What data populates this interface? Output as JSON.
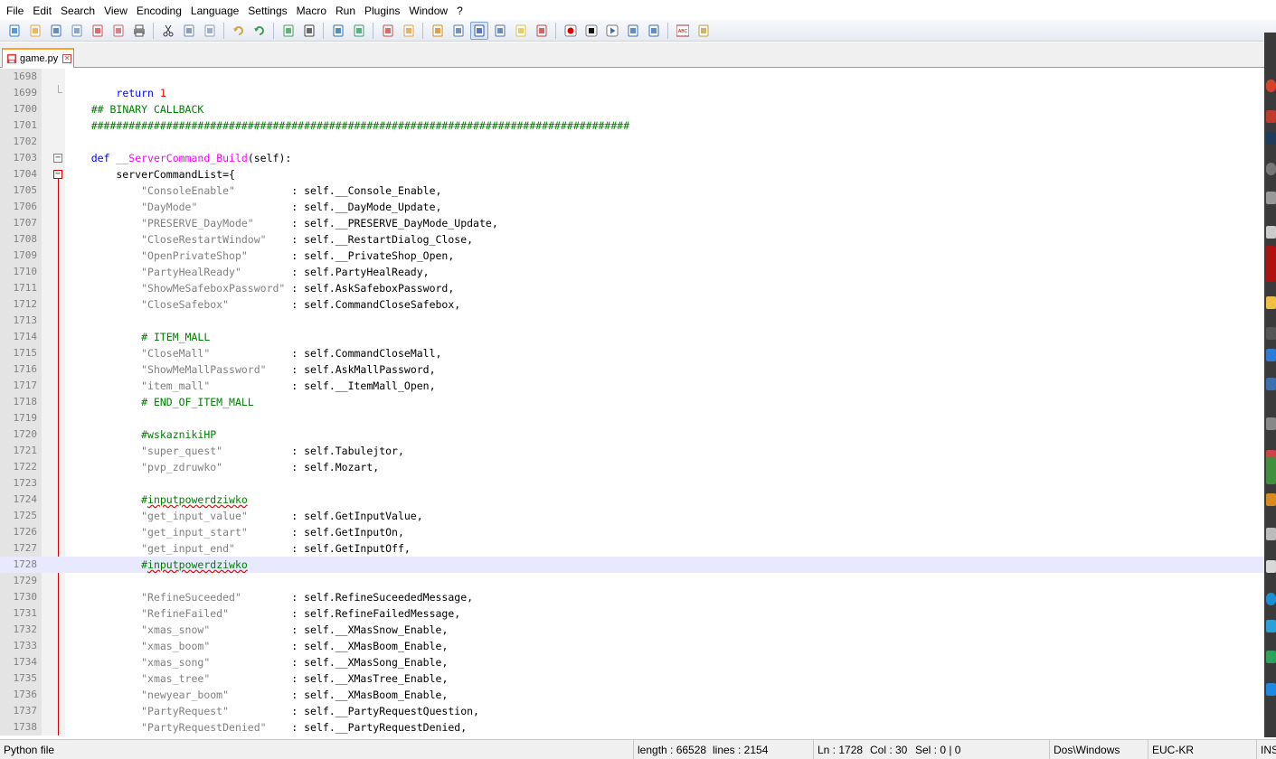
{
  "menu": [
    "File",
    "Edit",
    "Search",
    "View",
    "Encoding",
    "Language",
    "Settings",
    "Macro",
    "Run",
    "Plugins",
    "Window",
    "?"
  ],
  "toolbar": {
    "buttons": [
      "new-file-icon",
      "open-file-icon",
      "save-icon",
      "save-all-icon",
      "close-icon",
      "close-all-icon",
      "print-icon",
      "sep",
      "cut-icon",
      "copy-icon",
      "paste-icon",
      "sep",
      "undo-icon",
      "redo-icon",
      "sep",
      "find-icon",
      "replace-icon",
      "sep",
      "zoom-in-icon",
      "zoom-out-icon",
      "sep",
      "sync-vertical-icon",
      "sync-horizontal-icon",
      "sep",
      "word-wrap-icon",
      "show-all-chars-icon",
      "indent-guide-icon",
      "user-language-icon",
      "doc-map-icon",
      "function-list-icon",
      "sep",
      "record-macro-icon",
      "stop-macro-icon",
      "play-macro-icon",
      "run-macro-multiple-icon",
      "save-macro-icon",
      "sep",
      "spell-check-icon",
      "plugin-icon"
    ],
    "active": "indent-guide-icon"
  },
  "tabs": [
    {
      "label": "game.py"
    }
  ],
  "editor": {
    "current_line": "1728",
    "lines": [
      {
        "n": "1698",
        "fold": "",
        "html": ""
      },
      {
        "n": "1699",
        "fold": "end",
        "html": "        <span class='kw'>return</span> <span class='num'>1</span>"
      },
      {
        "n": "1700",
        "fold": "",
        "html": "    <span class='cmt'>## BINARY CALLBACK</span>"
      },
      {
        "n": "1701",
        "fold": "",
        "html": "    <span class='cmt'>######################################################################################</span>"
      },
      {
        "n": "1702",
        "fold": "",
        "html": ""
      },
      {
        "n": "1703",
        "fold": "minus",
        "html": "    <span class='kw'>def</span> <span class='fn'>__ServerCommand_Build</span>(self):"
      },
      {
        "n": "1704",
        "fold": "minus-red",
        "html": "        serverCommandList={"
      },
      {
        "n": "1705",
        "fold": "",
        "html": "            <span class='str'>\"ConsoleEnable\"</span>         : self.__Console_Enable,"
      },
      {
        "n": "1706",
        "fold": "",
        "html": "            <span class='str'>\"DayMode\"</span>               : self.__DayMode_Update,"
      },
      {
        "n": "1707",
        "fold": "",
        "html": "            <span class='str'>\"PRESERVE_DayMode\"</span>      : self.__PRESERVE_DayMode_Update,"
      },
      {
        "n": "1708",
        "fold": "",
        "html": "            <span class='str'>\"CloseRestartWindow\"</span>    : self.__RestartDialog_Close,"
      },
      {
        "n": "1709",
        "fold": "",
        "html": "            <span class='str'>\"OpenPrivateShop\"</span>       : self.__PrivateShop_Open,"
      },
      {
        "n": "1710",
        "fold": "",
        "html": "            <span class='str'>\"PartyHealReady\"</span>        : self.PartyHealReady,"
      },
      {
        "n": "1711",
        "fold": "",
        "html": "            <span class='str'>\"ShowMeSafeboxPassword\"</span> : self.AskSafeboxPassword,"
      },
      {
        "n": "1712",
        "fold": "",
        "html": "            <span class='str'>\"CloseSafebox\"</span>          : self.CommandCloseSafebox,"
      },
      {
        "n": "1713",
        "fold": "",
        "html": ""
      },
      {
        "n": "1714",
        "fold": "",
        "html": "            <span class='cmt'># ITEM_MALL</span>"
      },
      {
        "n": "1715",
        "fold": "",
        "html": "            <span class='str'>\"CloseMall\"</span>             : self.CommandCloseMall,"
      },
      {
        "n": "1716",
        "fold": "",
        "html": "            <span class='str'>\"ShowMeMallPassword\"</span>    : self.AskMallPassword,"
      },
      {
        "n": "1717",
        "fold": "",
        "html": "            <span class='str'>\"item_mall\"</span>             : self.__ItemMall_Open,"
      },
      {
        "n": "1718",
        "fold": "",
        "html": "            <span class='cmt'># END_OF_ITEM_MALL</span>"
      },
      {
        "n": "1719",
        "fold": "",
        "html": ""
      },
      {
        "n": "1720",
        "fold": "",
        "html": "            <span class='cmt'>#wskaznikiHP</span>"
      },
      {
        "n": "1721",
        "fold": "",
        "html": "            <span class='str'>\"super_quest\"</span>           : self.Tabulejtor,"
      },
      {
        "n": "1722",
        "fold": "",
        "html": "            <span class='str'>\"pvp_zdruwko\"</span>           : self.Mozart,"
      },
      {
        "n": "1723",
        "fold": "",
        "html": ""
      },
      {
        "n": "1724",
        "fold": "",
        "html": "            <span class='cmt'>#<span class='sq'>inputpowerdziwko</span></span>"
      },
      {
        "n": "1725",
        "fold": "",
        "html": "            <span class='str'>\"get_input_value\"</span>       : self.GetInputValue,"
      },
      {
        "n": "1726",
        "fold": "",
        "html": "            <span class='str'>\"get_input_start\"</span>       : self.GetInputOn,"
      },
      {
        "n": "1727",
        "fold": "",
        "html": "            <span class='str'>\"get_input_end\"</span>         : self.GetInputOff,"
      },
      {
        "n": "1728",
        "fold": "",
        "html": "            <span class='cmt'>#<span class='sq'>inputpowerdziwko</span></span>"
      },
      {
        "n": "1729",
        "fold": "",
        "html": ""
      },
      {
        "n": "1730",
        "fold": "",
        "html": "            <span class='str'>\"RefineSuceeded\"</span>        : self.RefineSuceededMessage,"
      },
      {
        "n": "1731",
        "fold": "",
        "html": "            <span class='str'>\"RefineFailed\"</span>          : self.RefineFailedMessage,"
      },
      {
        "n": "1732",
        "fold": "",
        "html": "            <span class='str'>\"xmas_snow\"</span>             : self.__XMasSnow_Enable,"
      },
      {
        "n": "1733",
        "fold": "",
        "html": "            <span class='str'>\"xmas_boom\"</span>             : self.__XMasBoom_Enable,"
      },
      {
        "n": "1734",
        "fold": "",
        "html": "            <span class='str'>\"xmas_song\"</span>             : self.__XMasSong_Enable,"
      },
      {
        "n": "1735",
        "fold": "",
        "html": "            <span class='str'>\"xmas_tree\"</span>             : self.__XMasTree_Enable,"
      },
      {
        "n": "1736",
        "fold": "",
        "html": "            <span class='str'>\"newyear_boom\"</span>          : self.__XMasBoom_Enable,"
      },
      {
        "n": "1737",
        "fold": "",
        "html": "            <span class='str'>\"PartyRequest\"</span>          : self.__PartyRequestQuestion,"
      },
      {
        "n": "1738",
        "fold": "",
        "html": "            <span class='str'>\"PartyRequestDenied\"</span>    : self.__PartyRequestDenied,"
      }
    ]
  },
  "status": {
    "file_type": "Python file",
    "length": "length : 66528",
    "lines": "lines : 2154",
    "ln": "Ln : 1728",
    "col": "Col : 30",
    "sel": "Sel : 0 | 0",
    "eol": "Dos\\Windows",
    "encoding": "EUC-KR",
    "mode": "INS"
  },
  "colors": {
    "keyword": "#0000ff",
    "number": "#ff0000",
    "comment": "#008000",
    "string": "#808080",
    "function": "#ff00ff",
    "current_line": "#e8e8ff",
    "tab_accent": "#f7a42b"
  }
}
